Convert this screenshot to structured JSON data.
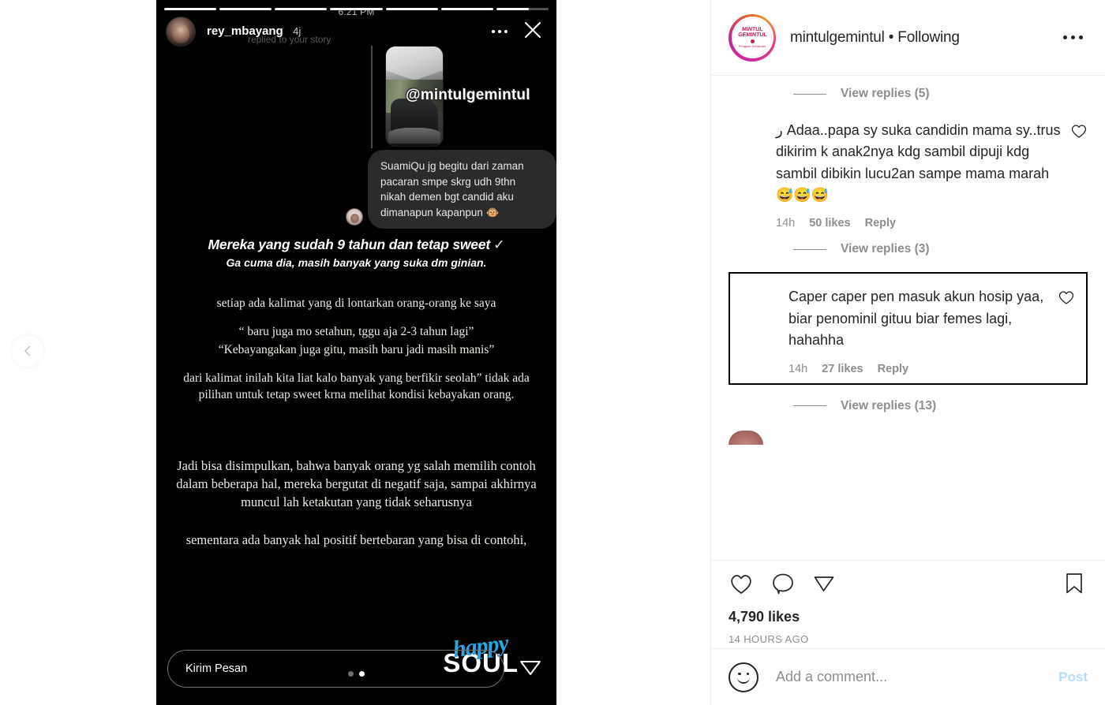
{
  "story": {
    "time": "6:21 PM",
    "progress_segments": [
      100,
      100,
      100,
      100,
      100,
      100,
      62
    ],
    "username": "rey_mbayang",
    "age": "4j",
    "replied_label": "replied to your story",
    "mention": "@mintulgemintul",
    "message": "SuamiQu jg begitu dari zaman pacaran smpe skrg udh 9thn nikah demen bgt candid aku dimanapun kapanpun 🐵",
    "title_line1": "Mereka yang sudah 9 tahun dan tetap sweet",
    "title_check": "✓",
    "title_line2": "Ga cuma dia, masih banyak yang suka dm ginian.",
    "body": [
      "setiap ada kalimat yang di lontarkan orang-orang ke saya",
      "“ baru juga mo setahun, tggu aja 2-3 tahun lagi”",
      "“Kebayangakan juga gitu, masih baru jadi masih manis”",
      "dari kalimat inilah kita liat kalo banyak yang berfikir seolah” tidak ada pilihan untuk tetap sweet krna melihat kondisi kebayakan orang."
    ],
    "body2": [
      "Jadi bisa disimpulkan, bahwa banyak orang yg salah memilih contoh dalam beberapa hal, mereka bergutat di negatif saja, sampai akhirnya muncul lah ketakutan yang tidak seharusnya",
      "sementara ada banyak hal positif bertebaran yang bisa di contohi,"
    ],
    "watermark_top": "happy",
    "watermark_bottom": "SOUL",
    "input_placeholder": "Kirim Pesan",
    "page_dots": [
      false,
      true
    ]
  },
  "post": {
    "account_name": "mintulgemintul",
    "following_label": "Following",
    "separator": "•",
    "header_title": "mintulgemintul • Following",
    "logo": {
      "line1": "MINTUL",
      "line2": "GEMINTUL",
      "sub": "Pengkuir Keharuan"
    },
    "top_view_replies": "View replies (5)",
    "comments": [
      {
        "text": "ر Adaa..papa sy suka candidin mama sy..trus dikirim k anak2nya kdg sambil dipuji kdg sambil dibikin lucu2an sampe mama marah😅😅😅",
        "time": "14h",
        "likes": "50 likes",
        "reply": "Reply",
        "view_replies": "View replies (3)",
        "highlighted": false
      },
      {
        "text": "Caper caper pen masuk akun hosip yaa, biar penominil gituu biar femes lagi, hahahha",
        "time": "14h",
        "likes": "27 likes",
        "reply": "Reply",
        "view_replies": "View replies (13)",
        "highlighted": true
      }
    ],
    "likes_count": "4,790 likes",
    "posted_ago": "14 HOURS AGO",
    "add_comment_placeholder": "Add a comment...",
    "post_button": "Post"
  },
  "colors": {
    "story_bg": "#000000",
    "panel_bg": "#ffffff",
    "text_primary": "#262626",
    "text_muted": "#8e8e8e",
    "post_blue": "#b2dffc",
    "watermark_blue": "#29a6e0",
    "highlight_border": "#000000"
  }
}
